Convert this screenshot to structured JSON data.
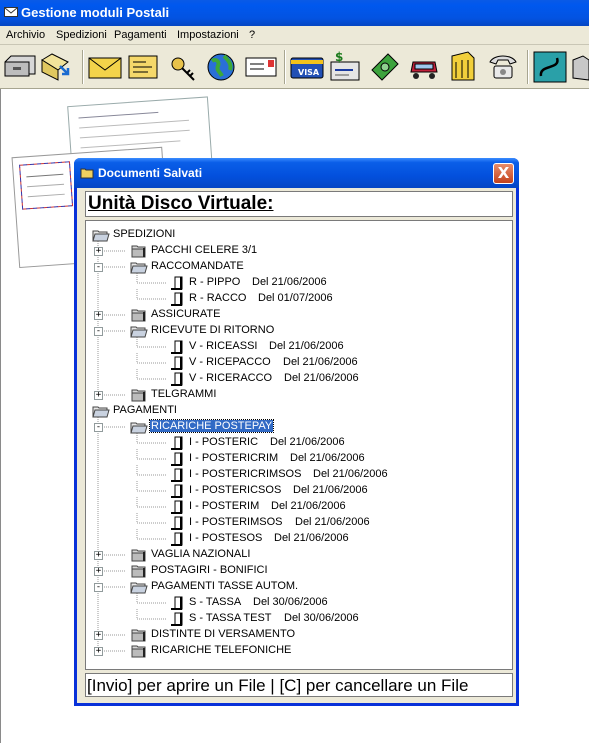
{
  "app": {
    "title": "Gestione moduli Postali"
  },
  "menu": [
    {
      "label": "Archivio"
    },
    {
      "label": "Spedizioni"
    },
    {
      "label": "Pagamenti"
    },
    {
      "label": "Impostazioni"
    },
    {
      "label": "?"
    }
  ],
  "toolbar": [
    {
      "icon": "open-drawer-icon"
    },
    {
      "icon": "open-folder-arrow-icon"
    },
    {
      "icon": "envelope-icon"
    },
    {
      "icon": "letter-icon"
    },
    {
      "icon": "key-icon"
    },
    {
      "icon": "globe-icon"
    },
    {
      "icon": "postcard-icon"
    },
    {
      "icon": "visa-card-icon"
    },
    {
      "icon": "money-check-icon"
    },
    {
      "icon": "banknotes-icon"
    },
    {
      "icon": "car-icon"
    },
    {
      "icon": "cabinet-icon"
    },
    {
      "icon": "telephone-icon"
    },
    {
      "icon": "chart-icon"
    },
    {
      "icon": "box-icon"
    }
  ],
  "dialog": {
    "title": "Documenti Salvati",
    "close_label": "X",
    "heading": "Unità Disco Virtuale:",
    "status": "[Invio] per aprire un File | [C] per cancellare un File"
  },
  "tree": [
    {
      "label": "SPEDIZIONI",
      "date": "",
      "level": 0,
      "kind": "open",
      "toggle": ""
    },
    {
      "label": "PACCHI CELERE 3/1",
      "date": "",
      "level": 1,
      "kind": "folder",
      "toggle": "+"
    },
    {
      "label": "RACCOMANDATE",
      "date": "",
      "level": 1,
      "kind": "open",
      "toggle": "-"
    },
    {
      "label": "R - PIPPO",
      "date": "Del 21/06/2006",
      "level": 2,
      "kind": "doc",
      "toggle": ""
    },
    {
      "label": "R - RACCO",
      "date": "Del 01/07/2006",
      "level": 2,
      "kind": "doc",
      "toggle": ""
    },
    {
      "label": "ASSICURATE",
      "date": "",
      "level": 1,
      "kind": "folder",
      "toggle": "+"
    },
    {
      "label": "RICEVUTE DI RITORNO",
      "date": "",
      "level": 1,
      "kind": "open",
      "toggle": "-"
    },
    {
      "label": "V - RICEASSI",
      "date": "Del 21/06/2006",
      "level": 2,
      "kind": "doc",
      "toggle": ""
    },
    {
      "label": "V - RICEPACCO",
      "date": "Del 21/06/2006",
      "level": 2,
      "kind": "doc",
      "toggle": ""
    },
    {
      "label": "V - RICERACCO",
      "date": "Del 21/06/2006",
      "level": 2,
      "kind": "doc",
      "toggle": ""
    },
    {
      "label": "TELGRAMMI",
      "date": "",
      "level": 1,
      "kind": "folder",
      "toggle": "+"
    },
    {
      "label": "PAGAMENTI",
      "date": "",
      "level": 0,
      "kind": "open",
      "toggle": ""
    },
    {
      "label": "RICARICHE POSTEPAY",
      "date": "",
      "level": 1,
      "kind": "open",
      "toggle": "-",
      "selected": true
    },
    {
      "label": "I - POSTERIC",
      "date": "Del 21/06/2006",
      "level": 2,
      "kind": "doc",
      "toggle": ""
    },
    {
      "label": "I - POSTERICRIM",
      "date": "Del 21/06/2006",
      "level": 2,
      "kind": "doc",
      "toggle": ""
    },
    {
      "label": "I - POSTERICRIMSOS",
      "date": "Del 21/06/2006",
      "level": 2,
      "kind": "doc",
      "toggle": ""
    },
    {
      "label": "I - POSTERICSOS",
      "date": "Del 21/06/2006",
      "level": 2,
      "kind": "doc",
      "toggle": ""
    },
    {
      "label": "I - POSTERIM",
      "date": "Del 21/06/2006",
      "level": 2,
      "kind": "doc",
      "toggle": ""
    },
    {
      "label": "I - POSTERIMSOS",
      "date": "Del 21/06/2006",
      "level": 2,
      "kind": "doc",
      "toggle": ""
    },
    {
      "label": "I - POSTESOS",
      "date": "Del 21/06/2006",
      "level": 2,
      "kind": "doc",
      "toggle": ""
    },
    {
      "label": "VAGLIA NAZIONALI",
      "date": "",
      "level": 1,
      "kind": "folder",
      "toggle": "+"
    },
    {
      "label": "POSTAGIRI - BONIFICI",
      "date": "",
      "level": 1,
      "kind": "folder",
      "toggle": "+"
    },
    {
      "label": "PAGAMENTI TASSE AUTOM.",
      "date": "",
      "level": 1,
      "kind": "open",
      "toggle": "-"
    },
    {
      "label": "S - TASSA",
      "date": "Del 30/06/2006",
      "level": 2,
      "kind": "doc",
      "toggle": ""
    },
    {
      "label": "S - TASSA TEST",
      "date": "Del 30/06/2006",
      "level": 2,
      "kind": "doc",
      "toggle": ""
    },
    {
      "label": "DISTINTE DI VERSAMENTO",
      "date": "",
      "level": 1,
      "kind": "folder",
      "toggle": "+"
    },
    {
      "label": "RICARICHE TELEFONICHE",
      "date": "",
      "level": 1,
      "kind": "folder",
      "toggle": "+"
    }
  ]
}
